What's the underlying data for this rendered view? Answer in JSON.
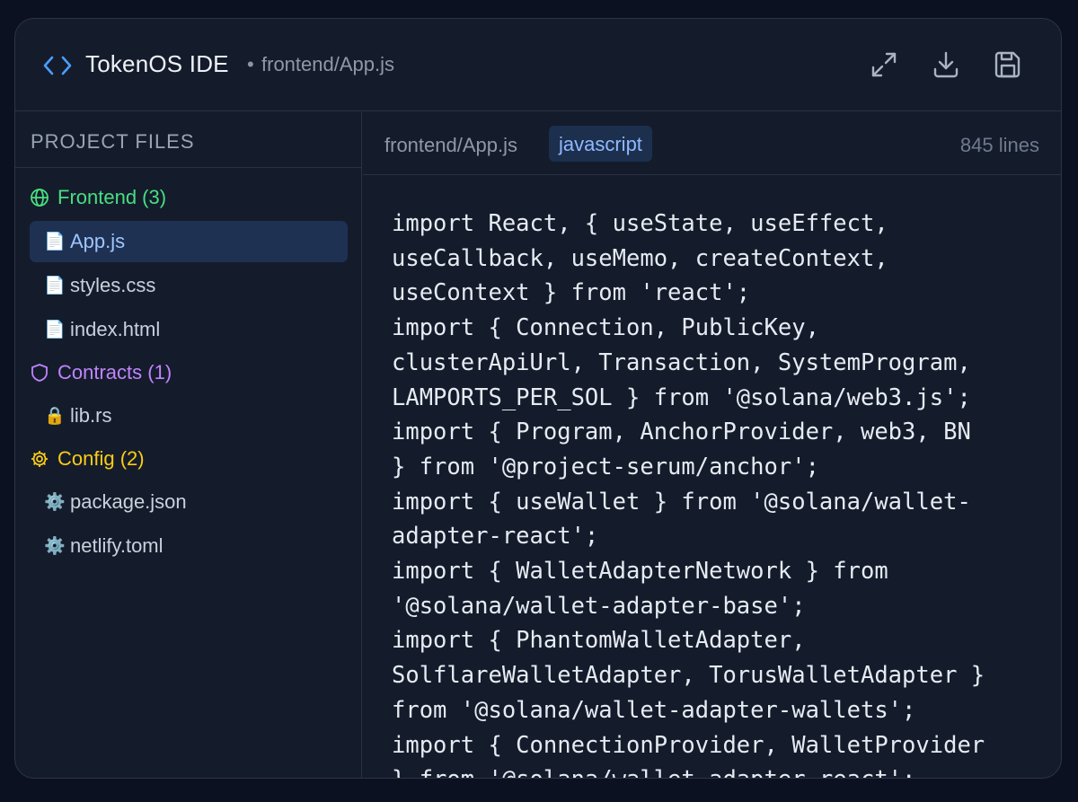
{
  "app": {
    "title": "TokenOS IDE",
    "separator": "•",
    "path": "frontend/App.js"
  },
  "toolbar": {
    "expand_icon": "expand-icon",
    "download_icon": "download-icon",
    "save_icon": "save-icon"
  },
  "sidebar": {
    "header": "PROJECT FILES",
    "groups": [
      {
        "label": "Frontend (3)",
        "icon": "globe-icon",
        "color": "#4ade80"
      },
      {
        "label": "Contracts (1)",
        "icon": "shield-icon",
        "color": "#c084fc"
      },
      {
        "label": "Config (2)",
        "icon": "gear-icon",
        "color": "#facc15"
      }
    ],
    "files": [
      {
        "name": "App.js",
        "icon": "📄",
        "active": true
      },
      {
        "name": "styles.css",
        "icon": "📄"
      },
      {
        "name": "index.html",
        "icon": "📄"
      },
      {
        "name": "lib.rs",
        "icon": "🔒"
      },
      {
        "name": "package.json",
        "icon": "⚙️"
      },
      {
        "name": "netlify.toml",
        "icon": "⚙️"
      }
    ]
  },
  "editor": {
    "path": "frontend/App.js",
    "language": "javascript",
    "line_count": "845 lines",
    "code": "import React, { useState, useEffect,\nuseCallback, useMemo, createContext,\nuseContext } from 'react';\nimport { Connection, PublicKey,\nclusterApiUrl, Transaction, SystemProgram,\nLAMPORTS_PER_SOL } from '@solana/web3.js';\nimport { Program, AnchorProvider, web3, BN\n} from '@project-serum/anchor';\nimport { useWallet } from '@solana/wallet-\nadapter-react';\nimport { WalletAdapterNetwork } from\n'@solana/wallet-adapter-base';\nimport { PhantomWalletAdapter,\nSolflareWalletAdapter, TorusWalletAdapter }\nfrom '@solana/wallet-adapter-wallets';\nimport { ConnectionProvider, WalletProvider\n} from '@solana/wallet-adapter-react';"
  }
}
